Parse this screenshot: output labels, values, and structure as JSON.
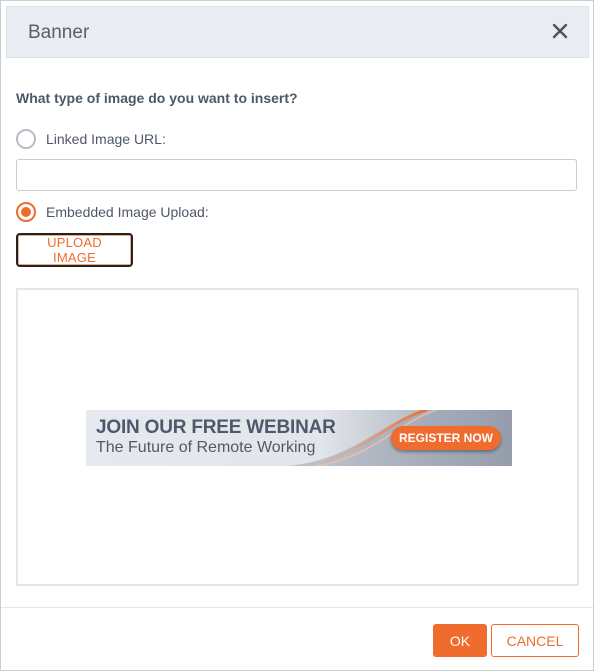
{
  "dialog": {
    "title": "Banner",
    "question": "What type of image do you want to insert?",
    "options": [
      {
        "label": "Linked Image URL:",
        "checked": false
      },
      {
        "label": "Embedded Image Upload:",
        "checked": true
      }
    ],
    "url_input": {
      "value": "",
      "placeholder": ""
    },
    "upload_button_label": "UPLOAD IMAGE",
    "ok_label": "OK",
    "cancel_label": "CANCEL"
  },
  "banner": {
    "title": "JOIN OUR FREE WEBINAR",
    "subtitle": "The Future of Remote Working",
    "cta_label": "REGISTER NOW"
  },
  "colors": {
    "accent": "#ef6c2e",
    "header_bg": "#e9ecf2",
    "text": "#4d5868"
  },
  "icons": {
    "close": "close-icon"
  }
}
